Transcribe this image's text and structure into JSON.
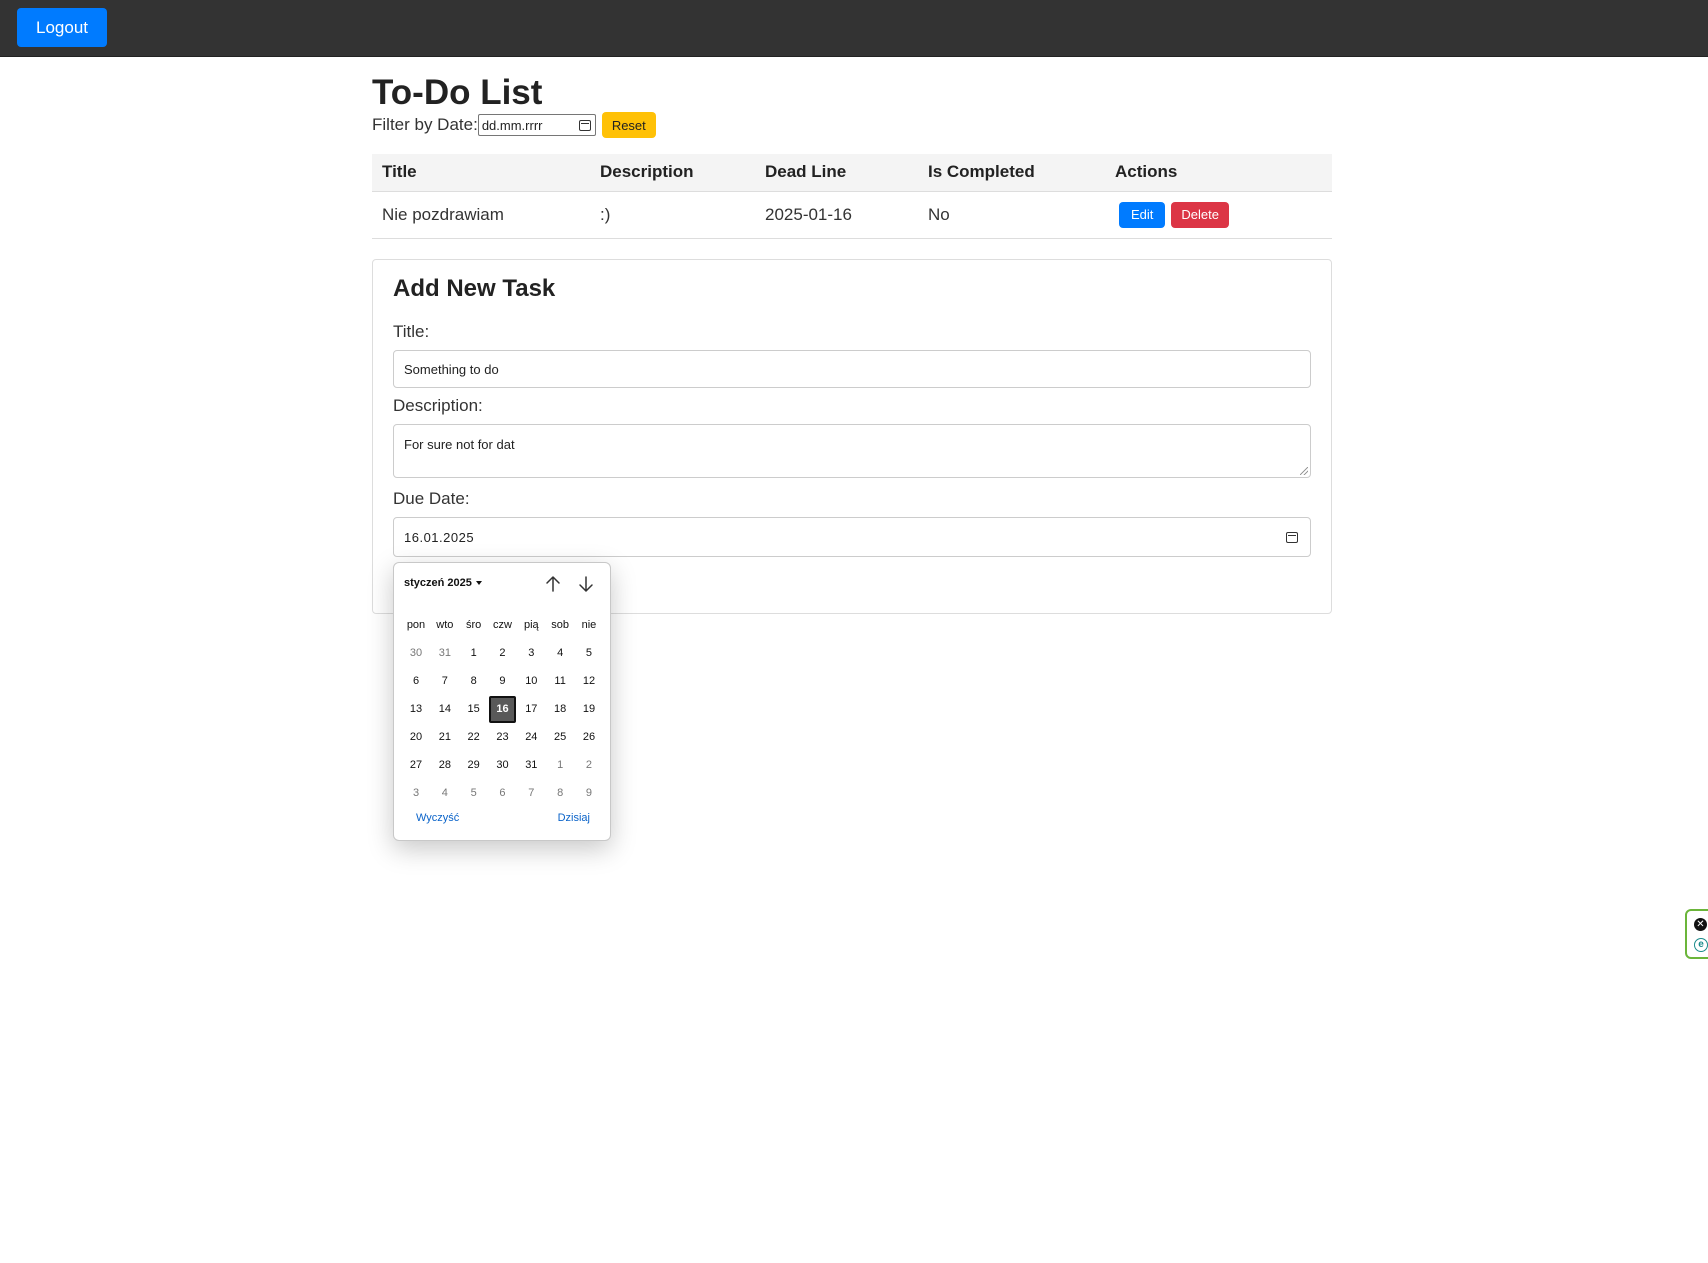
{
  "header": {
    "logout_label": "Logout"
  },
  "page": {
    "title": "To-Do List"
  },
  "filter": {
    "label": "Filter by Date:",
    "placeholder": "dd.mm.rrrr",
    "reset_label": "Reset"
  },
  "table": {
    "headers": [
      "Title",
      "Description",
      "Dead Line",
      "Is Completed",
      "Actions"
    ],
    "rows": [
      {
        "title": "Nie pozdrawiam",
        "description": ":)",
        "deadline": "2025-01-16",
        "completed": "No",
        "edit_label": "Edit",
        "delete_label": "Delete"
      }
    ]
  },
  "form": {
    "heading": "Add New Task",
    "title_label": "Title:",
    "title_value": "Something to do",
    "description_label": "Description:",
    "description_value": "For sure not for dat",
    "due_label": "Due Date:",
    "due_value": "16.01.2025"
  },
  "datepicker": {
    "month_label": "styczeń 2025",
    "weekdays": [
      "pon",
      "wto",
      "śro",
      "czw",
      "pią",
      "sob",
      "nie"
    ],
    "weeks": [
      [
        "30",
        "31",
        "1",
        "2",
        "3",
        "4",
        "5"
      ],
      [
        "6",
        "7",
        "8",
        "9",
        "10",
        "11",
        "12"
      ],
      [
        "13",
        "14",
        "15",
        "16",
        "17",
        "18",
        "19"
      ],
      [
        "20",
        "21",
        "22",
        "23",
        "24",
        "25",
        "26"
      ],
      [
        "27",
        "28",
        "29",
        "30",
        "31",
        "1",
        "2"
      ],
      [
        "3",
        "4",
        "5",
        "6",
        "7",
        "8",
        "9"
      ]
    ],
    "selected_day": "16",
    "clear_label": "Wyczyść",
    "today_label": "Dzisiaj"
  },
  "colors": {
    "primary": "#007bff",
    "danger": "#dc3545",
    "warning": "#ffc107",
    "topbar": "#333333",
    "widget_border": "#6bb53a"
  },
  "icons": [
    "calendar-icon",
    "chevron-down-icon",
    "arrow-up-icon",
    "arrow-down-icon",
    "close-icon",
    "extension-icon"
  ]
}
